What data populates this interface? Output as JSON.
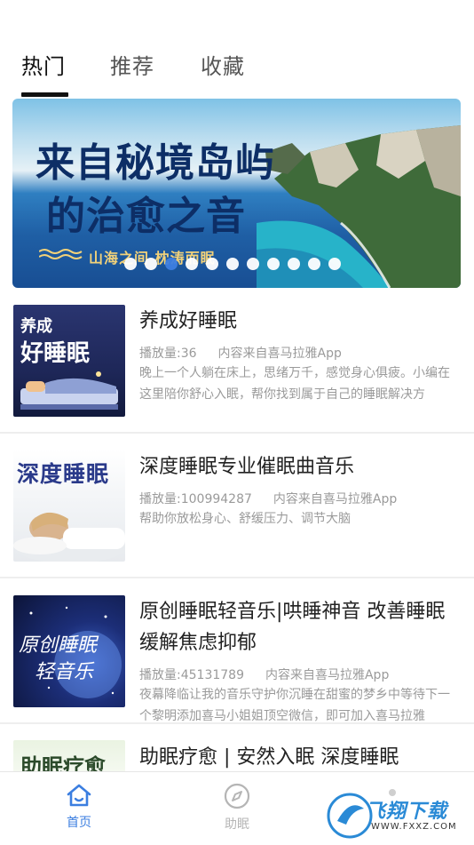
{
  "tabs": [
    {
      "label": "热门",
      "active": true
    },
    {
      "label": "推荐",
      "active": false
    },
    {
      "label": "收藏",
      "active": false
    }
  ],
  "banner": {
    "title_line1": "来自秘境岛屿",
    "title_line2": "的治愈之音",
    "subtitle": "山海之间 枕涛而眠",
    "dot_count": 11,
    "active_dot_index": 2,
    "colors": {
      "title": "#0d2e66",
      "subtitle": "#f2d27a",
      "dot_active": "#3d7ee0"
    }
  },
  "items": [
    {
      "thumb_text_top": "养成",
      "thumb_text_bottom": "好睡眠",
      "title": "养成好睡眠",
      "plays": "播放量:36",
      "source": "内容来自喜马拉雅App",
      "desc": "晚上一个人躺在床上，思绪万千，感觉身心俱疲。小编在这里陪你舒心入眠，帮你找到属于自己的睡眠解决方"
    },
    {
      "thumb_text": "深度睡眠",
      "title": "深度睡眠专业催眠曲音乐",
      "plays": "播放量:100994287",
      "source": "内容来自喜马拉雅App",
      "desc": "帮助你放松身心、舒缓压力、调节大脑"
    },
    {
      "thumb_text_top": "原创睡眠",
      "thumb_text_bottom": "轻音乐",
      "title": "原创睡眠轻音乐|哄睡神音 改善睡眠 缓解焦虑抑郁",
      "plays": "播放量:45131789",
      "source": "内容来自喜马拉雅App",
      "desc": "夜幕降临让我的音乐守护你沉睡在甜蜜的梦乡中等待下一个黎明添加喜马小姐姐顶空微信，即可加入喜马拉雅"
    },
    {
      "thumb_text": "助眠疗愈",
      "title": "助眠疗愈 | 安然入眠 深度睡眠"
    }
  ],
  "bottom_nav": [
    {
      "label": "首页",
      "icon": "home-icon",
      "active": true
    },
    {
      "label": "助眠",
      "icon": "compass-icon",
      "active": false
    }
  ],
  "watermark": {
    "text": "飞翔下载",
    "url": "WWW.FXXZ.COM"
  },
  "accent_color": "#3b7ee0"
}
